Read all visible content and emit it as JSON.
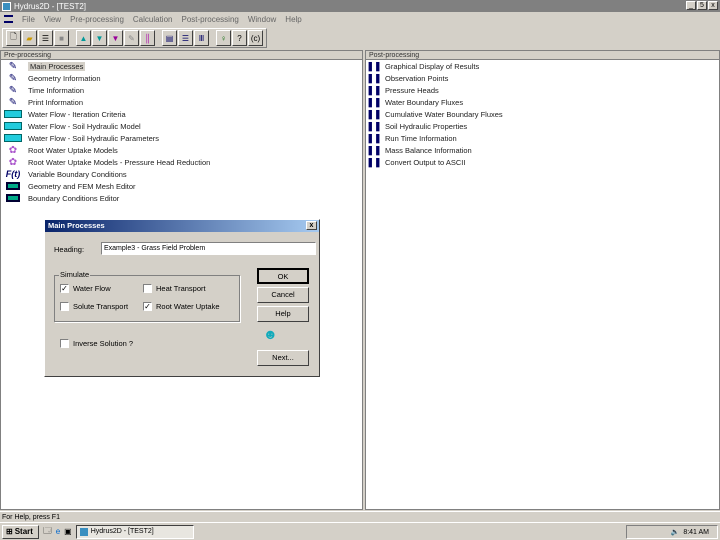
{
  "window": {
    "title": "Hydrus2D - [TEST2]",
    "min": "_",
    "max": "5",
    "close": "x"
  },
  "menu": [
    "File",
    "View",
    "Pre-processing",
    "Calculation",
    "Post-processing",
    "Window",
    "Help"
  ],
  "toolbar": {
    "about": "(c)"
  },
  "pre": {
    "header": "Pre-processing",
    "items": [
      {
        "label": "Main Processes",
        "icon": "pencil-icon"
      },
      {
        "label": "Geometry Information",
        "icon": "pencil-icon"
      },
      {
        "label": "Time Information",
        "icon": "pencil-icon"
      },
      {
        "label": "Print Information",
        "icon": "pencil-icon"
      },
      {
        "label": "Water Flow - Iteration Criteria",
        "icon": "water-icon"
      },
      {
        "label": "Water Flow - Soil Hydraulic Model",
        "icon": "water-icon"
      },
      {
        "label": "Water Flow - Soil Hydraulic Parameters",
        "icon": "water-icon"
      },
      {
        "label": "Root Water Uptake Models",
        "icon": "flower-icon"
      },
      {
        "label": "Root Water Uptake Models - Pressure Head Reduction",
        "icon": "flower-icon"
      },
      {
        "label": "Variable Boundary Conditions",
        "icon": "function-icon"
      },
      {
        "label": "Geometry and FEM Mesh Editor",
        "icon": "mesh-icon"
      },
      {
        "label": "Boundary Conditions Editor",
        "icon": "mesh-icon"
      }
    ]
  },
  "post": {
    "header": "Post-processing",
    "items": [
      "Graphical Display of Results",
      "Observation Points",
      "Pressure Heads",
      "Water Boundary Fluxes",
      "Cumulative Water Boundary Fluxes",
      "Soil Hydraulic Properties",
      "Run Time Information",
      "Mass Balance Information",
      "Convert Output to ASCII"
    ]
  },
  "dialog": {
    "title": "Main Processes",
    "close": "x",
    "heading_label": "Heading:",
    "heading_value": "Example3 - Grass Field Problem",
    "simulate_label": "Simulate",
    "water_flow": {
      "label": "Water Flow",
      "checked": true
    },
    "heat_transport": {
      "label": "Heat Transport",
      "checked": false
    },
    "solute_transport": {
      "label": "Solute Transport",
      "checked": false
    },
    "root_uptake": {
      "label": "Root Water Uptake",
      "checked": true
    },
    "inverse": {
      "label": "Inverse Solution ?",
      "checked": false
    },
    "ok": "OK",
    "cancel": "Cancel",
    "help": "Help",
    "next": "Next..."
  },
  "status": "For Help, press F1",
  "taskbar": {
    "start": "Start",
    "task": "Hydrus2D - [TEST2]",
    "clock": "8:41 AM"
  }
}
